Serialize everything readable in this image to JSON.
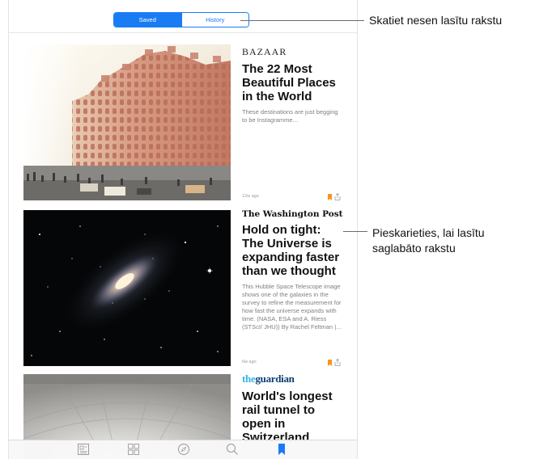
{
  "segmented": {
    "saved": "Saved",
    "history": "History",
    "selected": "Saved"
  },
  "articles": [
    {
      "source": "BAZAAR",
      "headline": "The 22 Most Beautiful Places in the World",
      "snippet": "These destinations are just begging to be Instagramme…",
      "time": "12w ago"
    },
    {
      "source": "The Washington Post",
      "headline": "Hold on tight: The Universe is expanding faster than we thought",
      "snippet": "This Hubble Space Telescope image shows one of the galaxies in the survey to refine the measurement for how fast the universe expands with time. (NASA, ESA and A. Riess (STScI/ JHU)) By Rachel Feltman |…",
      "time": "6w ago"
    },
    {
      "source_prefix": "the",
      "source_main": "guardian",
      "headline": "World's longest rail tunnel to open in Switzerland"
    }
  ],
  "tabbar": {
    "icons": [
      "for-you-icon",
      "explore-icon",
      "compass-icon",
      "search-icon",
      "bookmark-icon"
    ],
    "selected": "bookmark-icon"
  },
  "callouts": {
    "history": "Skatiet nesen lasītu rakstu",
    "saved_line1": "Pieskarieties, lai lasītu",
    "saved_line2": "saglabāto rakstu"
  },
  "colors": {
    "accent": "#1a7cf5",
    "bookmark": "#f7941d",
    "guardian_blue": "#0b3e72",
    "guardian_light": "#35b3ea"
  }
}
